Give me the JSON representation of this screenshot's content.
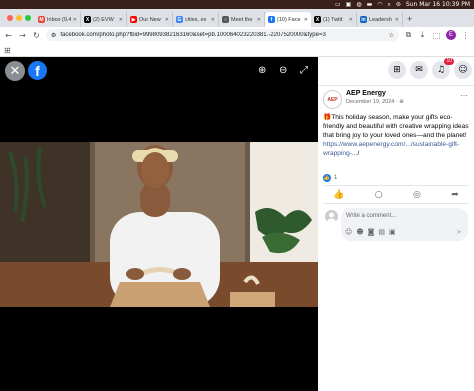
{
  "menubar": {
    "datetime": "Sun Mar 16  10:39 PM"
  },
  "tabs": [
    {
      "label": "Inbox (9,4",
      "fav_color": "#ea4335",
      "fav_glyph": "M"
    },
    {
      "label": "(2) EVW",
      "fav_color": "#000000",
      "fav_glyph": "X"
    },
    {
      "label": "Our New",
      "fav_color": "#ff0000",
      "fav_glyph": "▶"
    },
    {
      "label": "cities, ex",
      "fav_color": "#4285f4",
      "fav_glyph": "G"
    },
    {
      "label": "Meet the",
      "fav_color": "#555555",
      "fav_glyph": "○"
    },
    {
      "label": "(10) Face",
      "fav_color": "#1877f2",
      "fav_glyph": "f",
      "active": true
    },
    {
      "label": "(1) Twitt",
      "fav_color": "#000000",
      "fav_glyph": "X"
    },
    {
      "label": "Leadersh",
      "fav_color": "#0a66c2",
      "fav_glyph": "in"
    }
  ],
  "browser": {
    "url": "facebook.com/photo.php?fbid=999809382163160&set=pb.100064023220381.-2207520000&type=3",
    "profile_initial": "E"
  },
  "viewer": {
    "logo": "f"
  },
  "header": {
    "notification_count": "10"
  },
  "post": {
    "page_avatar_text": "AEP",
    "page_name": "AEP Energy",
    "date": "December 19, 2024 · ",
    "emoji": "🎁",
    "text": "This holiday season, make your gifts eco-friendly and beautiful with creative wrapping ideas that bring joy to your loved ones—and the planet!",
    "link": "https://www.aepenergy.com/.../sustainable-gift-wrapping-...",
    "link_suffix": "/",
    "reaction_count": "1"
  },
  "comment": {
    "placeholder": "Write a comment..."
  }
}
